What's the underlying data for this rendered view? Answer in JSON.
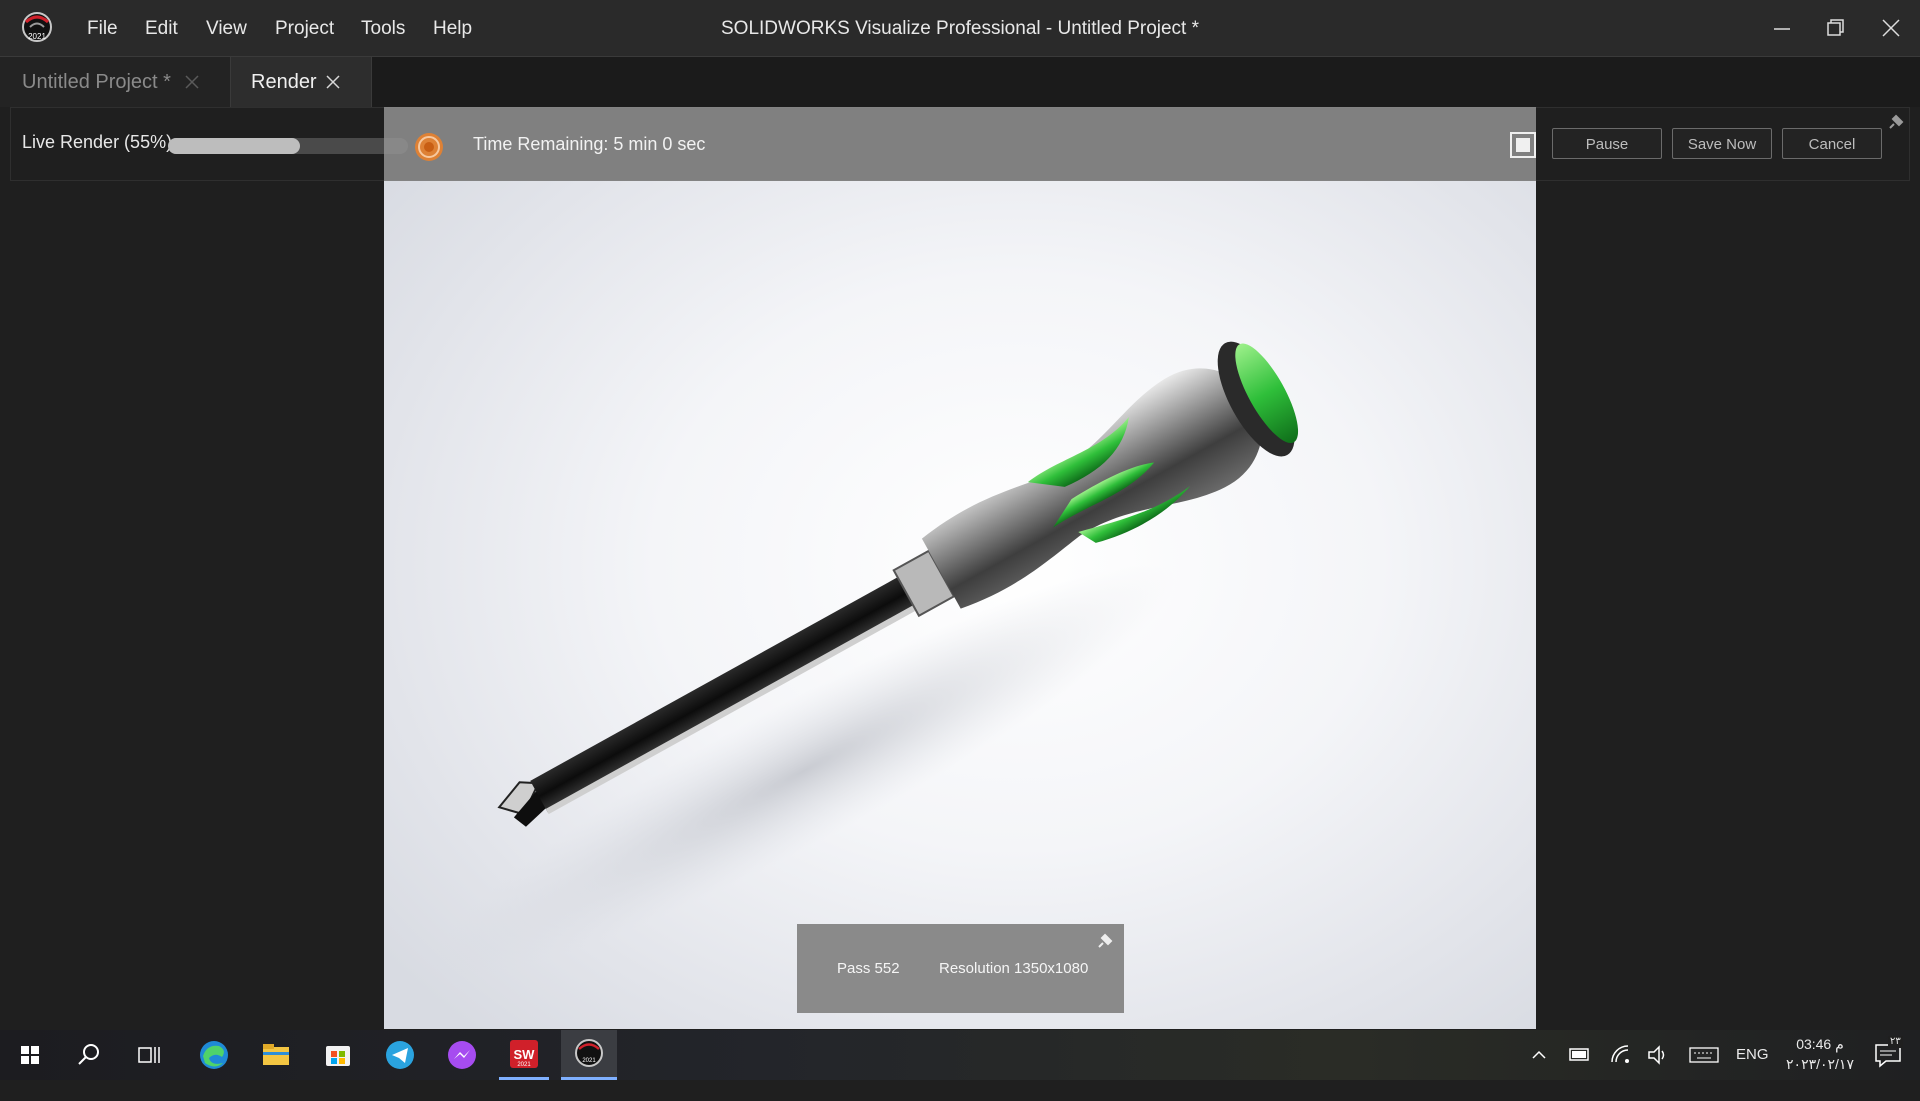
{
  "window": {
    "title": "SOLIDWORKS Visualize Professional - Untitled Project *",
    "logo_year": "2021",
    "menu": [
      "File",
      "Edit",
      "View",
      "Project",
      "Tools",
      "Help"
    ]
  },
  "tabs": [
    {
      "label": "Untitled Project *",
      "active": false
    },
    {
      "label": "Render",
      "active": true
    }
  ],
  "render": {
    "label": "Live Render (55%)",
    "progress": 0.55,
    "time_remaining": "Time Remaining: 5 min 0 sec",
    "buttons": {
      "pause": "Pause",
      "save_now": "Save Now",
      "cancel": "Cancel"
    }
  },
  "stats": {
    "pass": "Pass 552",
    "resolution": "Resolution 1350x1080"
  },
  "taskbar": {
    "apps": [
      "windows-start-icon",
      "search-icon",
      "task-view-icon",
      "edge-icon",
      "file-explorer-icon",
      "microsoft-store-icon",
      "telegram-icon",
      "messenger-icon",
      "solidworks-icon",
      "visualize-icon"
    ],
    "solidworks_badge": "SW",
    "solidworks_year": "2021",
    "visualize_year": "2021",
    "language": "ENG",
    "time": "03:46 م",
    "date": "٢٠٢٣/٠٢/١٧",
    "notification_count": "٢٣"
  },
  "colors": {
    "accent_green": "#2fbf3a",
    "stop_orange": "#e8812c",
    "solidworks_red": "#d0202a"
  }
}
